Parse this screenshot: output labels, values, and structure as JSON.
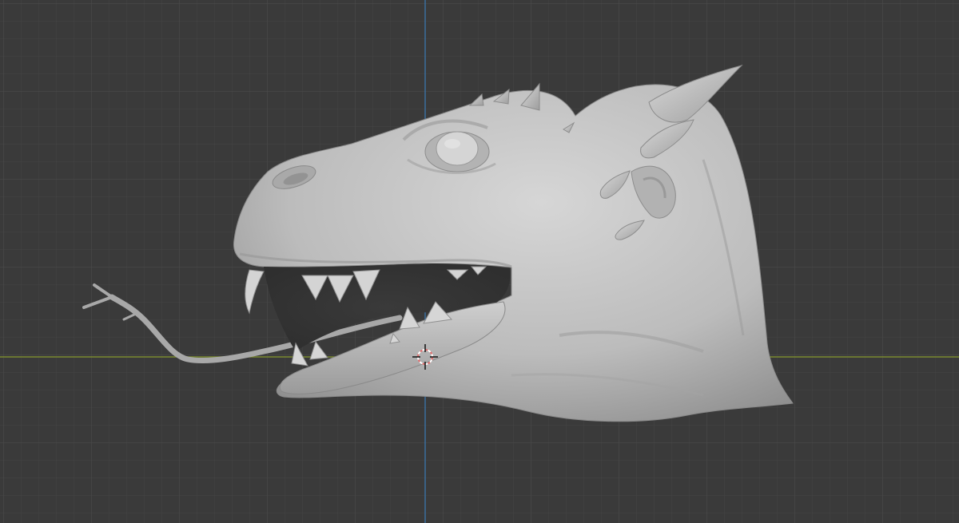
{
  "viewport": {
    "mode": "3D Viewport",
    "background_color": "#3a3a3a",
    "grid_minor_color": "#434343",
    "grid_major_color": "#4a4a4a",
    "x_axis_color": "#7a8a2f",
    "z_axis_color": "#3b6e9e"
  },
  "scene": {
    "object": "dragon-head-sculpt",
    "material_color": "#c7c7c7",
    "cursor": "3d-cursor"
  }
}
